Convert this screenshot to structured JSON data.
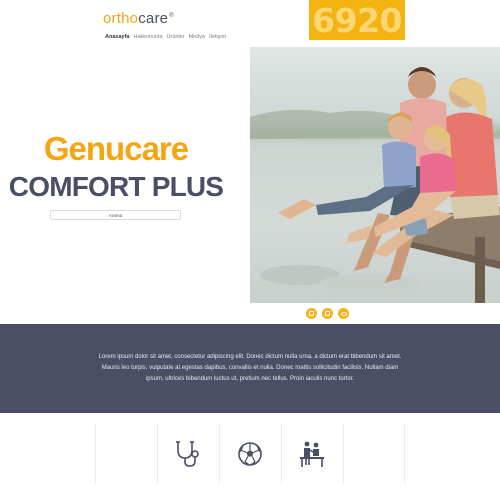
{
  "brand": {
    "logo_part1": "ortho",
    "logo_part2": "care",
    "logo_mark": "®"
  },
  "nav": {
    "items": [
      {
        "label": "Anasayfa",
        "active": true
      },
      {
        "label": "Hakkımızda",
        "active": false
      },
      {
        "label": "Ürünler",
        "active": false
      },
      {
        "label": "Medya",
        "active": false
      },
      {
        "label": "İletişim",
        "active": false
      }
    ]
  },
  "promo": {
    "text": "6920"
  },
  "hero": {
    "title_line1": "Genucare",
    "title_line2": "COMFORT PLUS",
    "search_placeholder": "Arama"
  },
  "band": {
    "text": "Lorem ipsum dolor sit amet, consectetur adipiscing elit. Donec dictum nulla urna, a dictum erat bibendum sit amet. Mauris leo turpis, vulputate at egestas dapibus, convallis et nulla. Donec mattis sollicitudin facilisis. Nullam diam ipsum, ultrices bibendum luctus ut, pretium nec tellus. Proin iaculis nunc tortor."
  },
  "features": {
    "icons": [
      "empty",
      "stethoscope-icon",
      "soccer-ball-icon",
      "physiotherapy-icon",
      "empty"
    ]
  },
  "colors": {
    "accent": "#f5a512",
    "navy": "#4b4f66",
    "promo_bg": "#f4b311"
  }
}
